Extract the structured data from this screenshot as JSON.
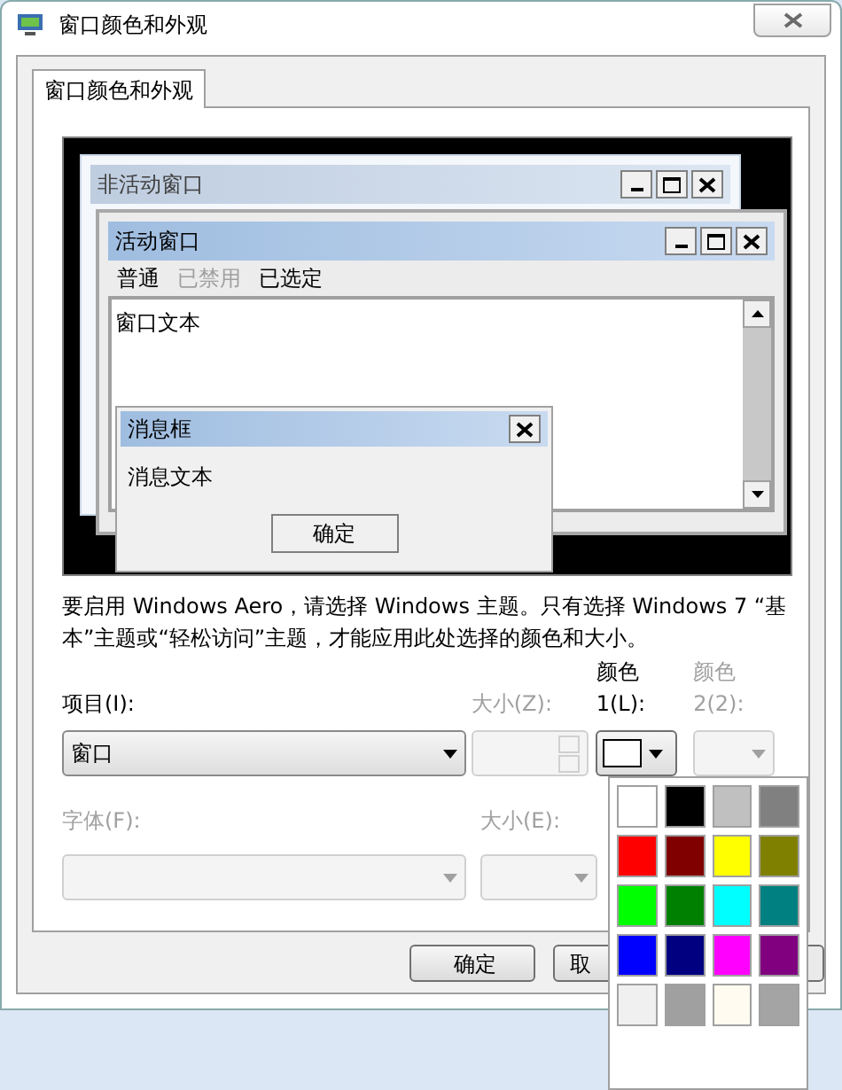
{
  "window": {
    "title": "窗口颜色和外观"
  },
  "tabs": [
    {
      "label": "窗口颜色和外观",
      "selected": true
    }
  ],
  "preview": {
    "inactive_window": {
      "title": "非活动窗口"
    },
    "active_window": {
      "title": "活动窗口",
      "menu": [
        {
          "label": "普通",
          "disabled": false
        },
        {
          "label": "已禁用",
          "disabled": true
        },
        {
          "label": "已选定",
          "disabled": false
        }
      ],
      "text": "窗口文本"
    },
    "message_box": {
      "title": "消息框",
      "text": "消息文本",
      "button": "确定"
    }
  },
  "description": "要启用 Windows Aero，请选择 Windows 主题。只有选择 Windows 7 “基本”主题或“轻松访问”主题，才能应用此处选择的颜色和大小。",
  "item": {
    "label": "项目(I):",
    "value": "窗口",
    "disabled": false
  },
  "item_size": {
    "label": "大小(Z):",
    "disabled": true
  },
  "color1": {
    "label": "颜色 1(L):",
    "color": "#ffffff",
    "disabled": false
  },
  "color2": {
    "label": "颜色 2(2):",
    "disabled": true
  },
  "font": {
    "label": "字体(F):",
    "disabled": true
  },
  "font_size": {
    "label": "大小(E):",
    "disabled": true
  },
  "palette": [
    {
      "color": "#ffffff"
    },
    {
      "color": "#000000"
    },
    {
      "color": "#c0c0c0"
    },
    {
      "color": "#808080"
    },
    {
      "color": "#ff0000"
    },
    {
      "color": "#800000"
    },
    {
      "color": "#ffff00"
    },
    {
      "color": "#808000"
    },
    {
      "color": "#00ff00"
    },
    {
      "color": "#008000"
    },
    {
      "color": "#00ffff"
    },
    {
      "color": "#008080"
    },
    {
      "color": "#0000ff"
    },
    {
      "color": "#000080"
    },
    {
      "color": "#ff00ff"
    },
    {
      "color": "#800080"
    },
    {
      "color": "#f0f0f0"
    },
    {
      "color": "#a0a0a0"
    },
    {
      "color": "#fffbf0"
    },
    {
      "color": "#a4a4a4"
    }
  ],
  "buttons": [
    {
      "label": "确定"
    },
    {
      "label": "取"
    }
  ]
}
